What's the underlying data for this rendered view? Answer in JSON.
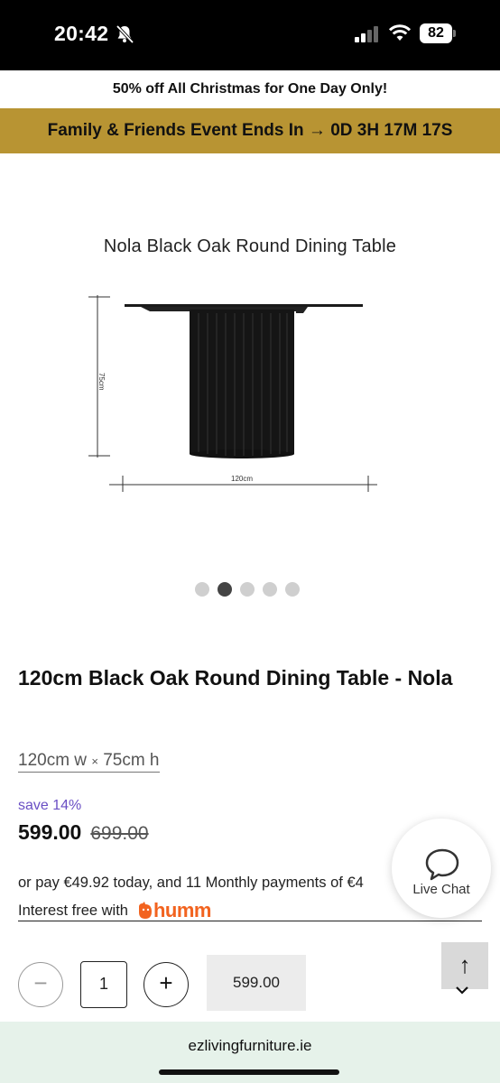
{
  "status_bar": {
    "time": "20:42",
    "battery": "82",
    "icons": [
      "bell-slash-icon",
      "signal-icon",
      "wifi-icon",
      "battery-icon"
    ]
  },
  "promo": {
    "text": "50% off All Christmas for One Day Only!"
  },
  "event": {
    "text": "Family & Friends Event Ends In → 0D 3H 17M 17S",
    "background": "#b89433"
  },
  "gallery": {
    "caption": "Nola Black Oak Round Dining Table",
    "height_label": "75cm",
    "width_label": "120cm",
    "slide_count": 5,
    "active_slide": 2
  },
  "product": {
    "title": "120cm Black Oak Round Dining Table - Nola",
    "variant_w": "120cm w",
    "variant_sep": "×",
    "variant_h": "75cm h",
    "save_label": "save 14%",
    "price": "599.00",
    "original_price": "699.00",
    "save_color": "#6a4fc4"
  },
  "payment": {
    "installments_text": "or pay €49.92 today, and 11 Monthly payments of €4",
    "interest_text": "Interest free with",
    "provider": "humm",
    "provider_color": "#f2631f"
  },
  "chat": {
    "label": "Live Chat"
  },
  "cart": {
    "minus": "−",
    "quantity": "1",
    "plus": "+",
    "button_price": "599.00"
  },
  "scroll_top": {
    "arrow": "↑"
  },
  "browser": {
    "url": "ezlivingfurniture.ie"
  }
}
